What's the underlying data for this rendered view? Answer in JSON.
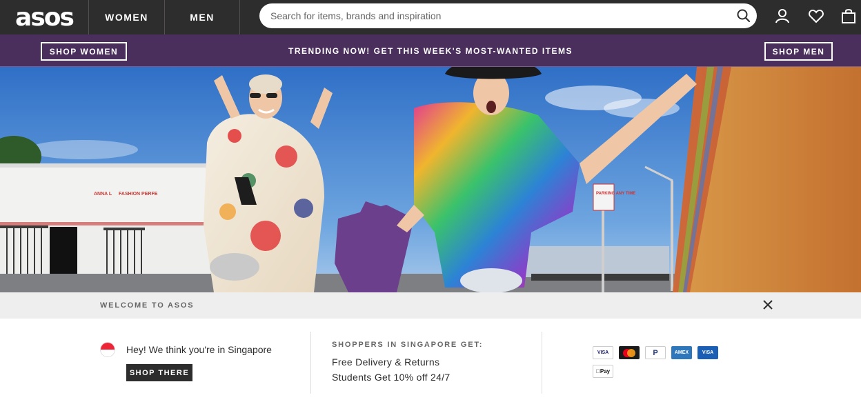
{
  "header": {
    "logo": "asos",
    "nav": [
      "WOMEN",
      "MEN"
    ],
    "search_placeholder": "Search for items, brands and inspiration"
  },
  "promo": {
    "left_button": "SHOP WOMEN",
    "center_text": "TRENDING NOW! GET THIS WEEK'S MOST-WANTED ITEMS",
    "right_button": "SHOP MEN"
  },
  "hero": {
    "sign_line1": "ANNA L",
    "sign_line2": "FASHION PERFE",
    "street_sign": "PARKING ANY TIME"
  },
  "welcome": {
    "title": "WELCOME TO ASOS",
    "hey_text": "Hey! We think you're in Singapore",
    "shop_there": "SHOP THERE",
    "shoppers_title": "SHOPPERS IN SINGAPORE GET:",
    "perks": [
      "Free Delivery & Returns",
      "Students Get 10% off 24/7"
    ]
  },
  "payments": [
    "VISA",
    "Mastercard",
    "PayPal",
    "AMEX",
    "VISA",
    "Pay"
  ],
  "colors": {
    "topbar": "#2d2d2d",
    "promo": "#4a2f5c",
    "sky": "#3b7fd1"
  }
}
